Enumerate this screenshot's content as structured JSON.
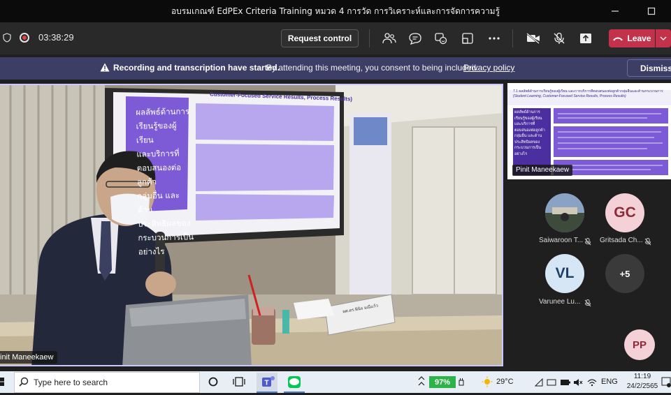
{
  "window": {
    "title": "อบรมเกณฑ์ EdPEx Criteria Training หมวด 4 การวัด การวิเคราะห์และการจัดการความรู้"
  },
  "toolbar": {
    "timer": "03:38:29",
    "request_control_label": "Request control",
    "leave_label": "Leave"
  },
  "banner": {
    "bold_text": "Recording and transcription have started.",
    "text": "By attending this meeting, you consent to being included.",
    "link": "Privacy policy",
    "dismiss_label": "Dismiss"
  },
  "main_video": {
    "speaker_name": "init Maneekaew",
    "slide_title_fragment": "Customer-Focused Service Results, Process Results)",
    "slide_left_text": [
      "ผลลัพธ์ด้านการ",
      "เรียนรู้ของผู้เรียน",
      "และบริการที่",
      "ตอบสนองต่อลูกค้า",
      "กลุ่มอื่น และด้าน",
      "ประสิทธิผลของ",
      "กระบวนการเป็น",
      "อย่างไร"
    ],
    "name_plate": "ผศ.ดร.พินิจ มณีแก้ว"
  },
  "shared_screen": {
    "name": "Pinit Maneekaew",
    "slide_title": "7.1 ผลลัพธ์ด้านการเรียนรู้ของผู้เรียน และการบริการที่ตอบสนองต่อลูกค้ากลุ่มอื่นและด้านกระบวนการ",
    "slide_subtitle": "(Student Learning, Customer-Focused Service Results, Process Results)",
    "slide_left_text": [
      "ผลลัพธ์ด้านการ",
      "เรียนรู้ของผู้เรียน",
      "และบริการที่",
      "ตอบสนองต่อลูกค้า",
      "กลุ่มอื่น และด้าน",
      "ประสิทธิผลของ",
      "กระบวนการเป็น",
      "อย่างไร"
    ]
  },
  "participants": [
    {
      "initials": "",
      "name": "Saiwaroon T...",
      "muted": true,
      "has_photo": true
    },
    {
      "initials": "GC",
      "name": "Gritsada Ch...",
      "muted": true,
      "color": "#f3d1d6",
      "text_color": "#8c2b3a"
    },
    {
      "initials": "VL",
      "name": "Varunee Lu...",
      "muted": true,
      "color": "#d7e6f5",
      "text_color": "#1d3f63"
    },
    {
      "initials": "+5",
      "name": "",
      "muted": false,
      "color": "#3a3a3a",
      "text_color": "#ffffff"
    },
    {
      "initials": "PP",
      "name": "",
      "muted": false,
      "color": "#f3d1d6",
      "text_color": "#8c2b3a"
    }
  ],
  "taskbar": {
    "search_placeholder": "Type here to search",
    "battery": "97%",
    "weather": "29°C",
    "language": "ENG",
    "time": "11:19",
    "date": "24/2/2565"
  },
  "colors": {
    "leave": "#c4314b",
    "banner": "#3d3e66",
    "slide_purple": "#7d5bd6"
  }
}
